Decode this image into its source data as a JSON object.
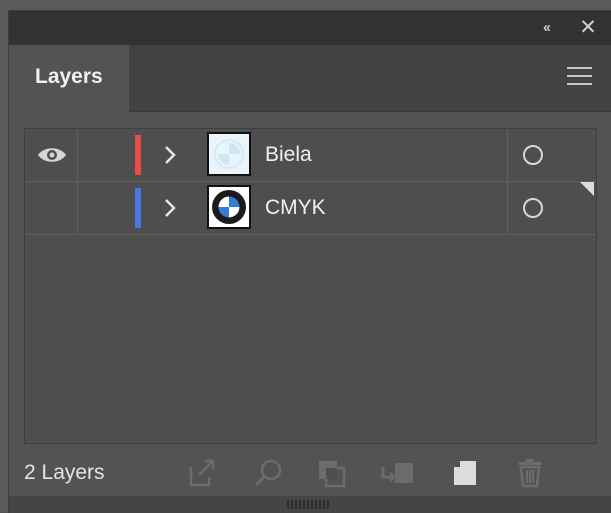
{
  "panel": {
    "tab_label": "Layers",
    "collapse_glyph": "‹‹",
    "close_glyph": "✕",
    "icons": {
      "collapse": "double-chevron-left-icon",
      "close": "close-icon",
      "menu": "hamburger-menu-icon"
    }
  },
  "layers": [
    {
      "name": "Biela",
      "visible": true,
      "color": "#e94a4a",
      "expanded": false,
      "thumbnail": "bmw-logo-white"
    },
    {
      "name": "CMYK",
      "visible": false,
      "color": "#4a78e9",
      "expanded": false,
      "thumbnail": "bmw-logo-color",
      "selected": true
    }
  ],
  "footer": {
    "count_label": "2 Layers",
    "buttons": [
      "export-icon",
      "locate-object-icon",
      "make-clipping-mask-icon",
      "create-sublayer-icon",
      "new-layer-icon",
      "trash-icon"
    ]
  },
  "colors": {
    "panel_bg": "#535353",
    "titlebar_bg": "#323232",
    "tabbar_bg": "#424242",
    "text": "#f0f0f0"
  }
}
